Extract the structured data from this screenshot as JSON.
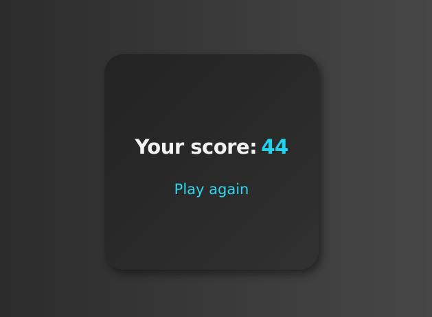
{
  "game_over": {
    "score_label": "Your score:",
    "score_value": "44",
    "play_again_label": "Play again"
  },
  "colors": {
    "accent": "#22d3ee",
    "text": "#f2f2f2",
    "card": "#2a2a2a",
    "background": "#3a3a3a"
  }
}
